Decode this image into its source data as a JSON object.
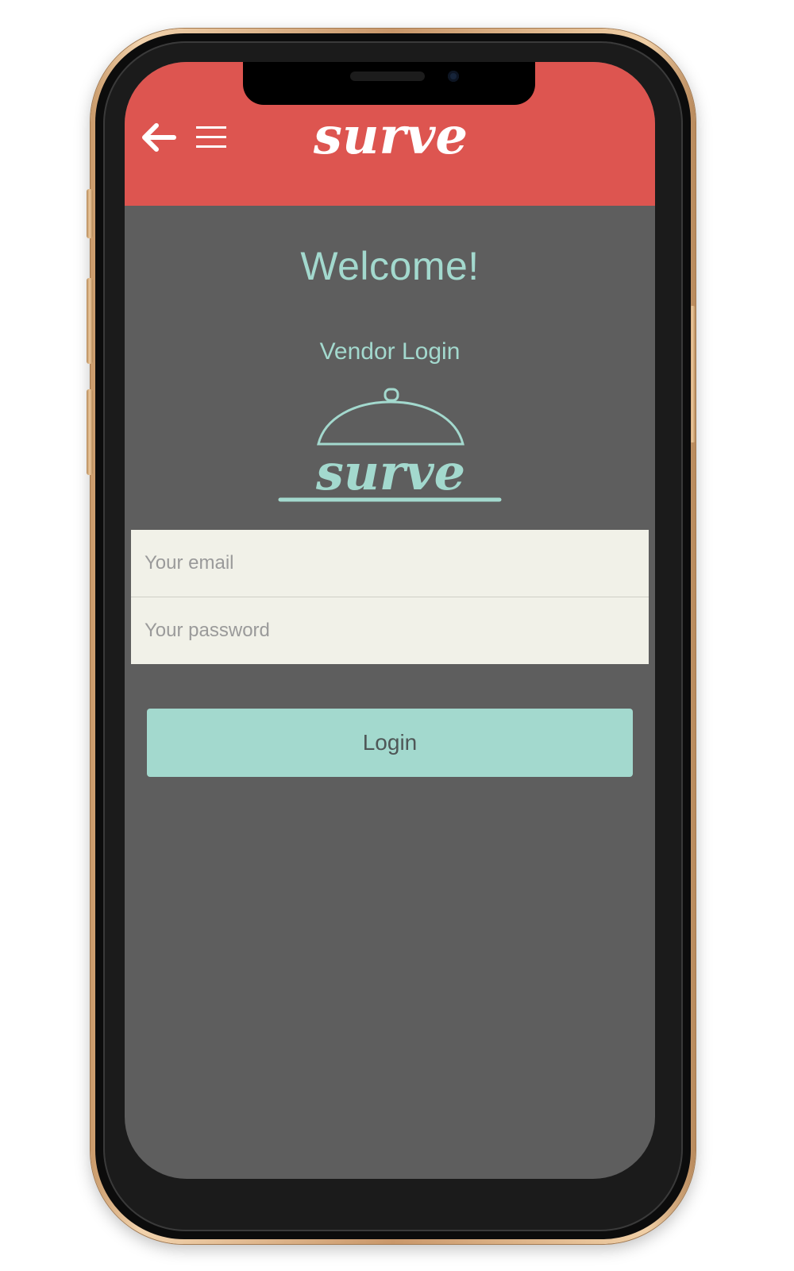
{
  "app": {
    "name": "surve",
    "colors": {
      "header": "#dd5550",
      "background": "#5e5e5e",
      "accent": "#a3d9ce",
      "input_bg": "#f1f1e8"
    }
  },
  "header": {
    "back_icon": "arrow-left-icon",
    "menu_icon": "hamburger-menu-icon",
    "logo_text": "surve"
  },
  "main": {
    "welcome": "Welcome!",
    "subtitle": "Vendor Login",
    "logo_icon": "cloche-icon",
    "logo_text": "surve"
  },
  "form": {
    "email_placeholder": "Your email",
    "email_value": "",
    "password_placeholder": "Your password",
    "password_value": "",
    "login_label": "Login"
  }
}
